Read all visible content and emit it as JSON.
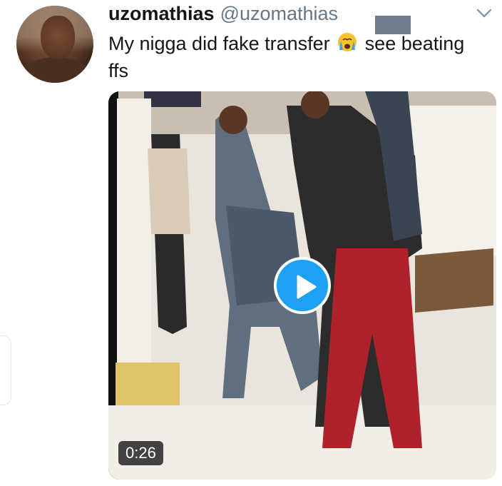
{
  "tweet": {
    "display_name": "uzomathias",
    "handle": "@uzomathias",
    "text_before_emoji": "My nigga did fake transfer ",
    "text_after_emoji": " see beating ffs",
    "emoji_icon": "crying-emoji-icon"
  },
  "video": {
    "duration": "0:26",
    "play_icon": "play-icon"
  },
  "colors": {
    "accent": "#1da1f2",
    "text": "#14171a",
    "muted": "#657786"
  }
}
